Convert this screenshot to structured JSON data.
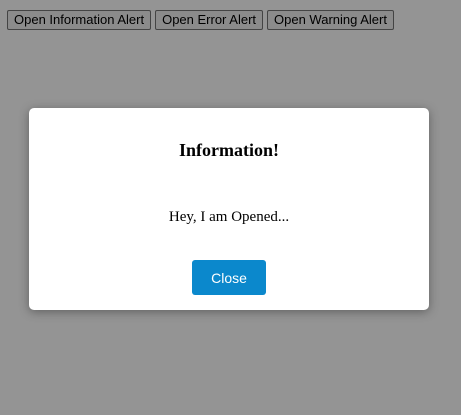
{
  "toolbar": {
    "info_button_label": "Open Information Alert",
    "error_button_label": "Open Error Alert",
    "warning_button_label": "Open Warning Alert"
  },
  "modal": {
    "title": "Information!",
    "message": "Hey, I am Opened...",
    "close_label": "Close",
    "close_button_color": "#0b88cc"
  },
  "overlay_color": "#969696"
}
